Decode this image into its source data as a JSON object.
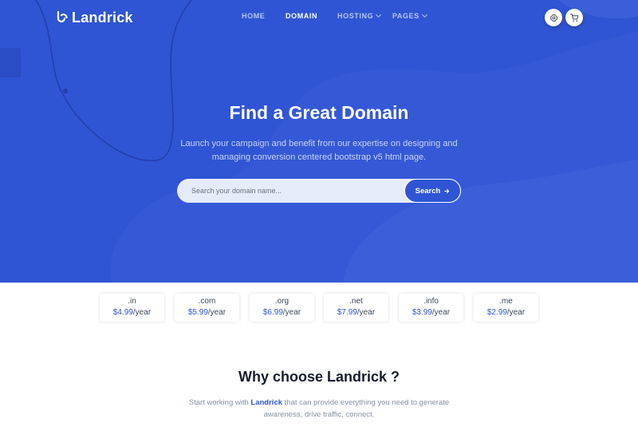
{
  "brand": {
    "name": "Landrick",
    "accent": "#2f55d4"
  },
  "nav": [
    {
      "label": "HOME",
      "active": false
    },
    {
      "label": "DOMAIN",
      "active": true
    },
    {
      "label": "HOSTING",
      "active": false,
      "dropdown": true
    },
    {
      "label": "PAGES",
      "active": false,
      "dropdown": true
    }
  ],
  "header_icons": [
    "gear-icon",
    "cart-icon"
  ],
  "hero": {
    "title": "Find a Great Domain",
    "subtitle": "Launch your campaign and benefit from our expertise on designing and managing conversion centered bootstrap v5 html page."
  },
  "search": {
    "placeholder": "Search your domain name...",
    "value": "",
    "button_label": "Search"
  },
  "tlds": [
    {
      "name": ".in",
      "price": "$4.99",
      "unit": "/year"
    },
    {
      "name": ".com",
      "price": "$5.99",
      "unit": "/year"
    },
    {
      "name": ".org",
      "price": "$6.99",
      "unit": "/year"
    },
    {
      "name": ".net",
      "price": "$7.99",
      "unit": "/year"
    },
    {
      "name": ".info",
      "price": "$3.99",
      "unit": "/year"
    },
    {
      "name": ".me",
      "price": "$2.99",
      "unit": "/year"
    }
  ],
  "why": {
    "title": "Why choose Landrick ?",
    "sub_before": "Start working with ",
    "sub_brand": "Landrick",
    "sub_after": " that can provide everything you need to generate awareness, drive traffic, connect."
  }
}
